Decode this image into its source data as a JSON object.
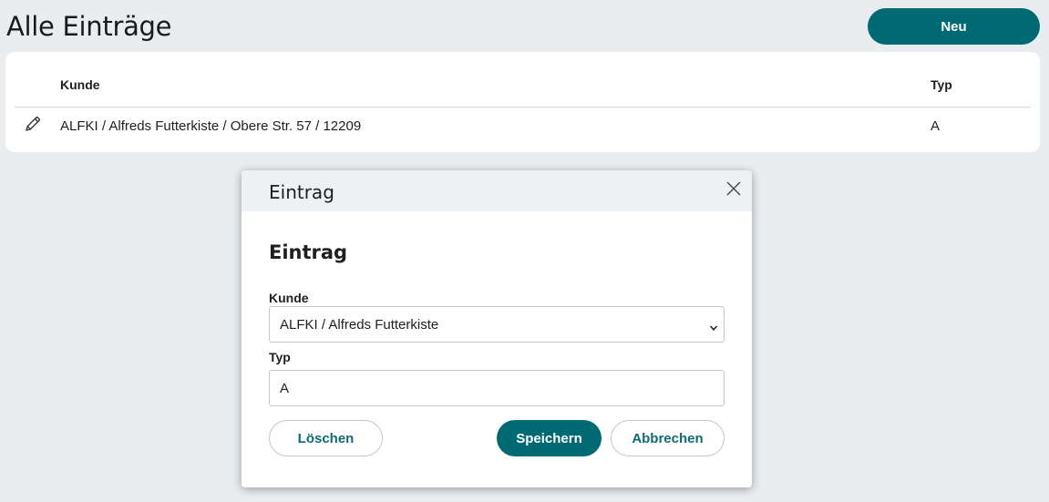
{
  "page": {
    "title": "Alle Einträge",
    "new_button": "Neu"
  },
  "table": {
    "columns": {
      "kunde": "Kunde",
      "typ": "Typ"
    },
    "rows": [
      {
        "kunde": "ALFKI / Alfreds Futterkiste / Obere Str. 57 / 12209",
        "typ": "A",
        "action_icon": "pencil-icon"
      }
    ]
  },
  "dialog": {
    "title": "Eintrag",
    "close_icon": "close-icon",
    "form_heading": "Eintrag",
    "fields": {
      "kunde": {
        "label": "Kunde",
        "value": "ALFKI / Alfreds Futterkiste"
      },
      "typ": {
        "label": "Typ",
        "value": "A"
      }
    },
    "buttons": {
      "delete": "Löschen",
      "save": "Speichern",
      "cancel": "Abbrechen"
    }
  },
  "colors": {
    "accent": "#006a73",
    "background": "#e9edf0",
    "dialog_header": "#edf1f4"
  }
}
